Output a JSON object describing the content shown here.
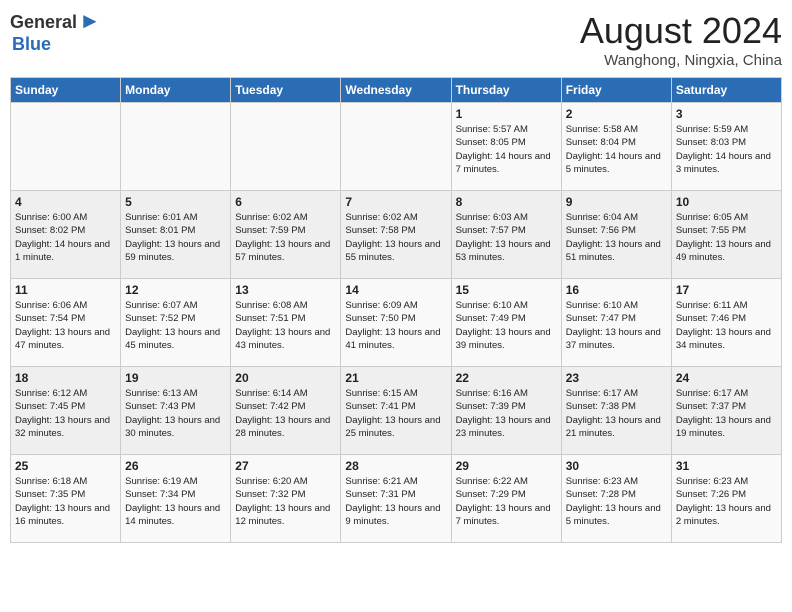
{
  "header": {
    "logo_general": "General",
    "logo_blue": "Blue",
    "month_year": "August 2024",
    "location": "Wanghong, Ningxia, China"
  },
  "weekdays": [
    "Sunday",
    "Monday",
    "Tuesday",
    "Wednesday",
    "Thursday",
    "Friday",
    "Saturday"
  ],
  "weeks": [
    [
      {
        "day": "",
        "info": ""
      },
      {
        "day": "",
        "info": ""
      },
      {
        "day": "",
        "info": ""
      },
      {
        "day": "",
        "info": ""
      },
      {
        "day": "1",
        "info": "Sunrise: 5:57 AM\nSunset: 8:05 PM\nDaylight: 14 hours and 7 minutes."
      },
      {
        "day": "2",
        "info": "Sunrise: 5:58 AM\nSunset: 8:04 PM\nDaylight: 14 hours and 5 minutes."
      },
      {
        "day": "3",
        "info": "Sunrise: 5:59 AM\nSunset: 8:03 PM\nDaylight: 14 hours and 3 minutes."
      }
    ],
    [
      {
        "day": "4",
        "info": "Sunrise: 6:00 AM\nSunset: 8:02 PM\nDaylight: 14 hours and 1 minute."
      },
      {
        "day": "5",
        "info": "Sunrise: 6:01 AM\nSunset: 8:01 PM\nDaylight: 13 hours and 59 minutes."
      },
      {
        "day": "6",
        "info": "Sunrise: 6:02 AM\nSunset: 7:59 PM\nDaylight: 13 hours and 57 minutes."
      },
      {
        "day": "7",
        "info": "Sunrise: 6:02 AM\nSunset: 7:58 PM\nDaylight: 13 hours and 55 minutes."
      },
      {
        "day": "8",
        "info": "Sunrise: 6:03 AM\nSunset: 7:57 PM\nDaylight: 13 hours and 53 minutes."
      },
      {
        "day": "9",
        "info": "Sunrise: 6:04 AM\nSunset: 7:56 PM\nDaylight: 13 hours and 51 minutes."
      },
      {
        "day": "10",
        "info": "Sunrise: 6:05 AM\nSunset: 7:55 PM\nDaylight: 13 hours and 49 minutes."
      }
    ],
    [
      {
        "day": "11",
        "info": "Sunrise: 6:06 AM\nSunset: 7:54 PM\nDaylight: 13 hours and 47 minutes."
      },
      {
        "day": "12",
        "info": "Sunrise: 6:07 AM\nSunset: 7:52 PM\nDaylight: 13 hours and 45 minutes."
      },
      {
        "day": "13",
        "info": "Sunrise: 6:08 AM\nSunset: 7:51 PM\nDaylight: 13 hours and 43 minutes."
      },
      {
        "day": "14",
        "info": "Sunrise: 6:09 AM\nSunset: 7:50 PM\nDaylight: 13 hours and 41 minutes."
      },
      {
        "day": "15",
        "info": "Sunrise: 6:10 AM\nSunset: 7:49 PM\nDaylight: 13 hours and 39 minutes."
      },
      {
        "day": "16",
        "info": "Sunrise: 6:10 AM\nSunset: 7:47 PM\nDaylight: 13 hours and 37 minutes."
      },
      {
        "day": "17",
        "info": "Sunrise: 6:11 AM\nSunset: 7:46 PM\nDaylight: 13 hours and 34 minutes."
      }
    ],
    [
      {
        "day": "18",
        "info": "Sunrise: 6:12 AM\nSunset: 7:45 PM\nDaylight: 13 hours and 32 minutes."
      },
      {
        "day": "19",
        "info": "Sunrise: 6:13 AM\nSunset: 7:43 PM\nDaylight: 13 hours and 30 minutes."
      },
      {
        "day": "20",
        "info": "Sunrise: 6:14 AM\nSunset: 7:42 PM\nDaylight: 13 hours and 28 minutes."
      },
      {
        "day": "21",
        "info": "Sunrise: 6:15 AM\nSunset: 7:41 PM\nDaylight: 13 hours and 25 minutes."
      },
      {
        "day": "22",
        "info": "Sunrise: 6:16 AM\nSunset: 7:39 PM\nDaylight: 13 hours and 23 minutes."
      },
      {
        "day": "23",
        "info": "Sunrise: 6:17 AM\nSunset: 7:38 PM\nDaylight: 13 hours and 21 minutes."
      },
      {
        "day": "24",
        "info": "Sunrise: 6:17 AM\nSunset: 7:37 PM\nDaylight: 13 hours and 19 minutes."
      }
    ],
    [
      {
        "day": "25",
        "info": "Sunrise: 6:18 AM\nSunset: 7:35 PM\nDaylight: 13 hours and 16 minutes."
      },
      {
        "day": "26",
        "info": "Sunrise: 6:19 AM\nSunset: 7:34 PM\nDaylight: 13 hours and 14 minutes."
      },
      {
        "day": "27",
        "info": "Sunrise: 6:20 AM\nSunset: 7:32 PM\nDaylight: 13 hours and 12 minutes."
      },
      {
        "day": "28",
        "info": "Sunrise: 6:21 AM\nSunset: 7:31 PM\nDaylight: 13 hours and 9 minutes."
      },
      {
        "day": "29",
        "info": "Sunrise: 6:22 AM\nSunset: 7:29 PM\nDaylight: 13 hours and 7 minutes."
      },
      {
        "day": "30",
        "info": "Sunrise: 6:23 AM\nSunset: 7:28 PM\nDaylight: 13 hours and 5 minutes."
      },
      {
        "day": "31",
        "info": "Sunrise: 6:23 AM\nSunset: 7:26 PM\nDaylight: 13 hours and 2 minutes."
      }
    ]
  ]
}
